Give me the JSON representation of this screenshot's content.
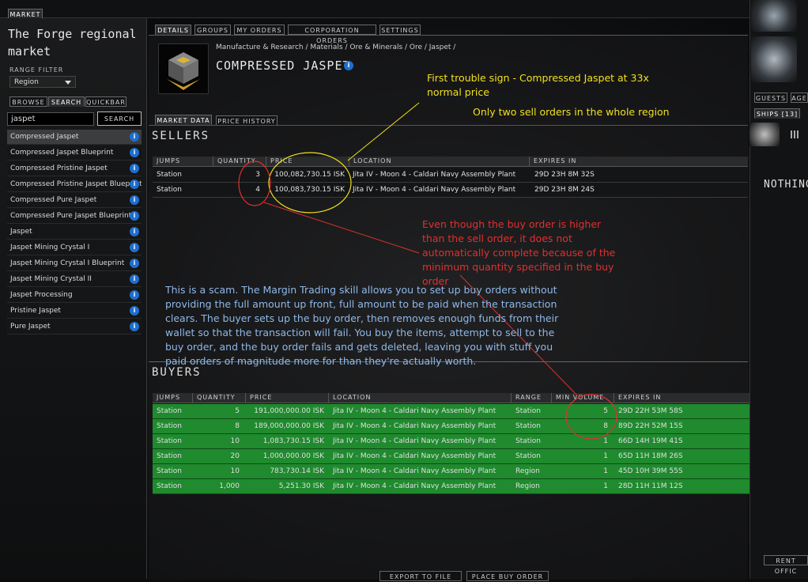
{
  "window": {
    "title": "MARKET"
  },
  "left": {
    "region_title": "The Forge regional market",
    "range_label": "RANGE FILTER",
    "range_value": "Region",
    "tabs": [
      "BROWSE",
      "SEARCH",
      "QUICKBAR"
    ],
    "search_value": "jaspet",
    "search_button": "SEARCH",
    "results": [
      "Compressed Jaspet",
      "Compressed Jaspet Blueprint",
      "Compressed Pristine Jaspet",
      "Compressed Pristine Jaspet Blueprint",
      "Compressed Pure Jaspet",
      "Compressed Pure Jaspet Blueprint",
      "Jaspet",
      "Jaspet Mining Crystal I",
      "Jaspet Mining Crystal I Blueprint",
      "Jaspet Mining Crystal II",
      "Jaspet Processing",
      "Pristine Jaspet",
      "Pure Jaspet"
    ]
  },
  "main_tabs": [
    "DETAILS",
    "GROUPS",
    "MY ORDERS",
    "CORPORATION ORDERS",
    "SETTINGS"
  ],
  "item": {
    "breadcrumb": "Manufacture & Research / Materials / Ore & Minerals / Ore / Jaspet /",
    "name": "COMPRESSED JASPET"
  },
  "sub_tabs": [
    "MARKET DATA",
    "PRICE HISTORY"
  ],
  "sellers": {
    "title": "SELLERS",
    "columns": [
      "JUMPS",
      "QUANTITY",
      "PRICE",
      "LOCATION",
      "EXPIRES IN"
    ],
    "rows": [
      {
        "jumps": "Station",
        "qty": "3",
        "price": "100,082,730.15 ISK",
        "location": "Jita IV - Moon 4 - Caldari Navy Assembly Plant",
        "expires": "29D 23H 8M 32S"
      },
      {
        "jumps": "Station",
        "qty": "4",
        "price": "100,083,730.15 ISK",
        "location": "Jita IV - Moon 4 - Caldari Navy Assembly Plant",
        "expires": "29D 23H 8M 24S"
      }
    ]
  },
  "buyers": {
    "title": "BUYERS",
    "columns": [
      "JUMPS",
      "QUANTITY",
      "PRICE",
      "LOCATION",
      "RANGE",
      "MIN VOLUME",
      "EXPIRES IN"
    ],
    "rows": [
      {
        "jumps": "Station",
        "qty": "5",
        "price": "191,000,000.00 ISK",
        "location": "Jita IV - Moon 4 - Caldari Navy Assembly Plant",
        "range": "Station",
        "min": "5",
        "expires": "29D 22H 53M 58S"
      },
      {
        "jumps": "Station",
        "qty": "8",
        "price": "189,000,000.00 ISK",
        "location": "Jita IV - Moon 4 - Caldari Navy Assembly Plant",
        "range": "Station",
        "min": "8",
        "expires": "89D 22H 52M 15S"
      },
      {
        "jumps": "Station",
        "qty": "10",
        "price": "1,083,730.15 ISK",
        "location": "Jita IV - Moon 4 - Caldari Navy Assembly Plant",
        "range": "Station",
        "min": "1",
        "expires": "66D 14H 19M 41S"
      },
      {
        "jumps": "Station",
        "qty": "20",
        "price": "1,000,000.00 ISK",
        "location": "Jita IV - Moon 4 - Caldari Navy Assembly Plant",
        "range": "Station",
        "min": "1",
        "expires": "65D 11H 18M 26S"
      },
      {
        "jumps": "Station",
        "qty": "10",
        "price": "783,730.14 ISK",
        "location": "Jita IV - Moon 4 - Caldari Navy Assembly Plant",
        "range": "Region",
        "min": "1",
        "expires": "45D 10H 39M 55S"
      },
      {
        "jumps": "Station",
        "qty": "1,000",
        "price": "5,251.30 ISK",
        "location": "Jita IV - Moon 4 - Caldari Navy Assembly Plant",
        "range": "Region",
        "min": "1",
        "expires": "28D 11H 11M 12S"
      }
    ]
  },
  "bottom_buttons": [
    "EXPORT TO FILE",
    "PLACE BUY ORDER"
  ],
  "right": {
    "tabs": [
      "GUESTS",
      "AGE",
      "SHIPS [13]"
    ],
    "nothing": "NOTHING",
    "rent": "RENT OFFIC"
  },
  "annotations": {
    "yellow1": "First trouble sign - Compressed Jaspet at 33x normal price",
    "yellow2": "Only two sell orders in the whole region",
    "red": "Even though the buy order is higher than the sell order, it does not automatically complete because of the minimum quantity specified in the buy order",
    "blue": "This is a scam. The Margin Trading skill allows you to set up buy orders without providing the full amount up front, full amount to be paid when the transaction clears. The buyer sets up the buy order, then removes enough funds from their wallet so that the transaction will fail. You buy the items, attempt to sell to the buy order, and the buy order fails and gets deleted, leaving you with stuff you paid orders of magnitude more for than they're actually worth."
  },
  "colors": {
    "yellow": "#f0e020",
    "red": "#e03030",
    "blue": "#8fb8e8",
    "buy_row": "#1f8a2e",
    "info": "#1e6fd0"
  }
}
